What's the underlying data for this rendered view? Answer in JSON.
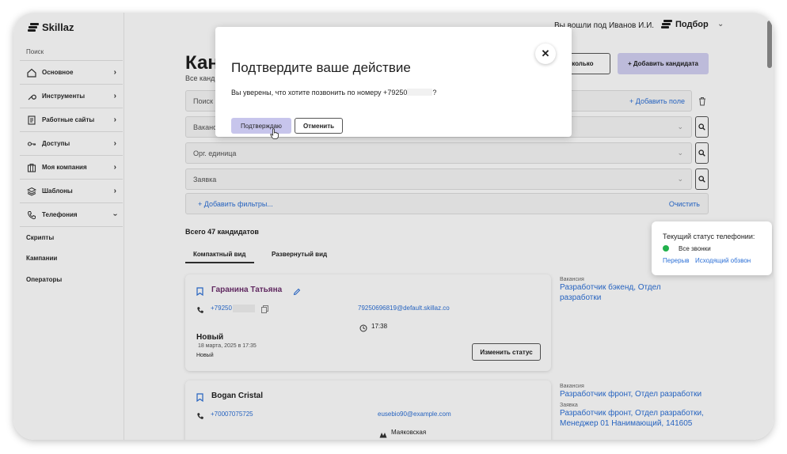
{
  "app": {
    "logo": "Skillaz"
  },
  "sidebar": {
    "search_label": "Поиск",
    "items": [
      {
        "label": "Основное",
        "icon": "home-icon"
      },
      {
        "label": "Инструменты",
        "icon": "wrench-icon"
      },
      {
        "label": "Работные сайты",
        "icon": "document-icon"
      },
      {
        "label": "Доступы",
        "icon": "key-icon"
      },
      {
        "label": "Моя компания",
        "icon": "building-icon"
      },
      {
        "label": "Шаблоны",
        "icon": "layers-icon"
      },
      {
        "label": "Телефония",
        "icon": "phone-icon"
      }
    ],
    "sub_items": [
      "Скрипты",
      "Кампании",
      "Операторы"
    ]
  },
  "topbar": {
    "user": "Вы вошли под Иванов И.И.",
    "brand": "Подбор"
  },
  "page": {
    "title": "Кан",
    "subtitle": "Все канд",
    "btn_some": "есколько",
    "btn_add": "+ Добавить кандидата",
    "search_placeholder": "Поиск",
    "add_field": "+ Добавить поле",
    "vacancy_placeholder": "Ваканс",
    "org_placeholder": "Орг. единица",
    "request_placeholder": "Заявка",
    "add_filters": "+ Добавить фильтры...",
    "clear": "Очистить",
    "total": "Всего 47 кандидатов",
    "tabs": [
      "Компактный вид",
      "Развернутый вид"
    ]
  },
  "cards": [
    {
      "name": "Гаранина Татьяна",
      "phone": "+79250",
      "email": "79250696819@default.skillaz.co",
      "meta": "17:38",
      "status": "Новый",
      "date": "18 марта, 2025 в 17:35",
      "small": "Новый",
      "button": "Изменить статус",
      "side": [
        {
          "label": "Вакансия",
          "value": "Разработчик бэкенд, Отдел разработки"
        }
      ]
    },
    {
      "name": "Bogan Cristal",
      "phone": "+70007075725",
      "email": "eusebio90@example.com",
      "meta": "Маяковская",
      "side": [
        {
          "label": "Вакансия",
          "value": "Разработчик фронт, Отдел разработки"
        },
        {
          "label": "Заявка",
          "value": "Разработчик фронт, Отдел разработки, Менеджер 01 Нанимающий, 141605"
        }
      ]
    }
  ],
  "modal": {
    "title": "Подтвердите ваше действие",
    "text_before": "Вы уверены, что хотите позвонить по номеру +79250",
    "text_after": "?",
    "confirm": "Подтверждаю",
    "cancel": "Отменить"
  },
  "telephony_popup": {
    "title": "Текущий статус телефонии:",
    "status": "Все звонки",
    "status_color": "#22b14c",
    "link1": "Перерыв",
    "link2": "Исходящий обзвон"
  },
  "colors": {
    "accent": "#d3d1f3",
    "link": "#2b6fd6",
    "name_purple": "#6b2d6b"
  }
}
